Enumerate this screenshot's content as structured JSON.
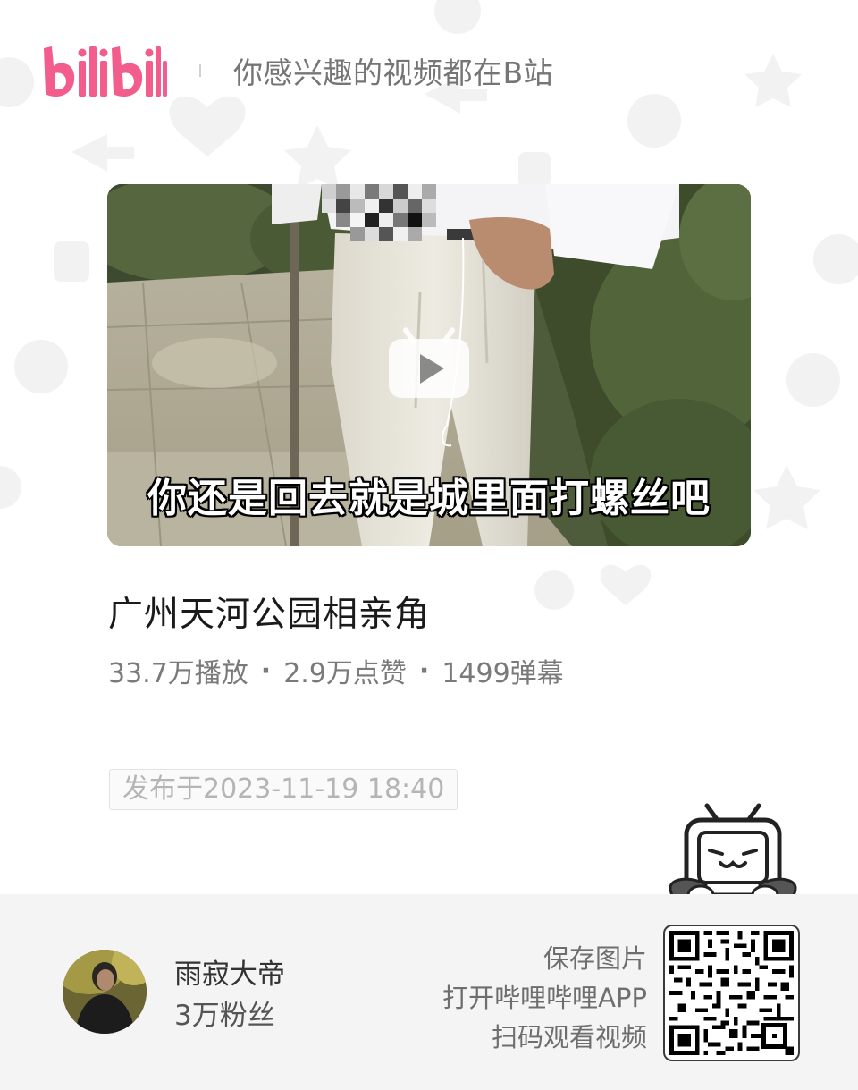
{
  "header": {
    "logo_text": "bilibili",
    "slogan": "你感兴趣的视频都在B站"
  },
  "video": {
    "subtitle": "你还是回去就是城里面打螺丝吧",
    "title": "广州天河公园相亲角",
    "stats": {
      "views": "33.7万播放",
      "likes": "2.9万点赞",
      "danmaku": "1499弹幕",
      "separator": "·"
    },
    "publish_date": "发布于2023-11-19 18:40"
  },
  "footer": {
    "uploader_name": "雨寂大帝",
    "followers": "3万粉丝",
    "cta_lines": [
      "保存图片",
      "打开哔哩哔哩APP",
      "扫码观看视频"
    ]
  },
  "colors": {
    "brand_pink": "#f25d8e",
    "footer_bg": "#f4f4f4",
    "text_dark": "#1a1a1a",
    "text_gray": "#7a7a7a"
  },
  "icons": {
    "logo": "bilibili-logo",
    "play": "bilibili-tv-play-icon",
    "mascot": "bilibili-tv-mascot",
    "qr": "qr-code"
  }
}
